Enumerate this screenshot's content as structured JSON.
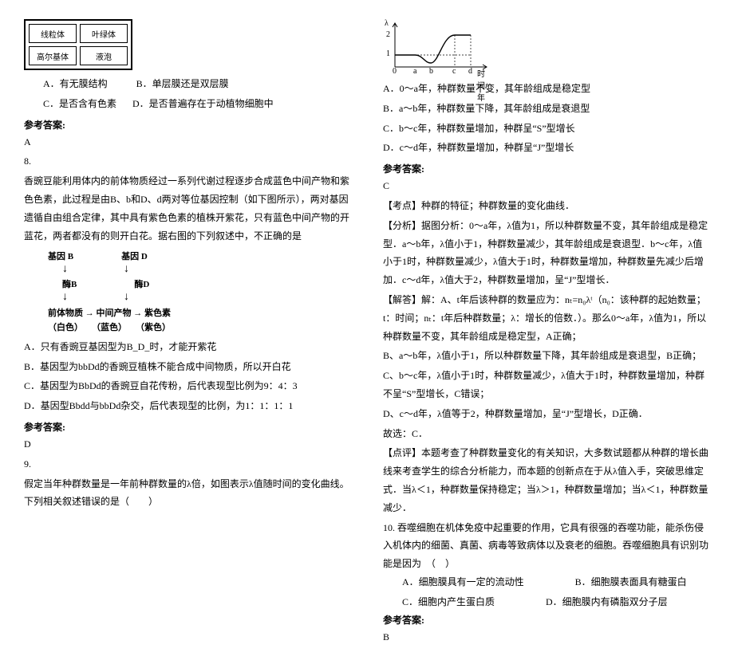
{
  "left": {
    "cell_labels": [
      "线粒体",
      "叶绿体",
      "高尔基体",
      "液泡"
    ],
    "q7_optA": "A．有无膜结构",
    "q7_optB": "B．单层膜还是双层膜",
    "q7_optC": "C．是否含有色素",
    "q7_optD": "D．是否普遍存在于动植物细胞中",
    "ref_label": "参考答案:",
    "q7_ans": "A",
    "q8_num": "8.",
    "q8_text": "香豌豆能利用体内的前体物质经过一系列代谢过程逐步合成蓝色中间产物和紫色色素，此过程是由B、b和D、d两对等位基因控制（如下图所示），两对基因遗循自由组合定律，其中具有紫色色素的植株开紫花，只有蓝色中间产物的开蓝花，两者都没有的则开白花。据右图的下列叙述中，不正确的是",
    "geneB": "基因 B",
    "geneD": "基因 D",
    "enzymeB": "酶B",
    "enzymeD": "酶D",
    "bottom_line": "前体物质 → 中间产物 → 紫色素",
    "bottom_colors": "（白色）　　（蓝色）　　（紫色）",
    "q8_optA": "A．只有香豌豆基因型为B_D_时，才能开紫花",
    "q8_optB": "B．基因型为bbDd的香豌豆植株不能合成中间物质，所以开白花",
    "q8_optC": "C．基因型为BbDd的香豌豆自花传粉，后代表现型比例为9：4：3",
    "q8_optD": "D．基因型Bbdd与bbDd杂交，后代表现型的比例，为1：1：1：1",
    "q8_ans": "D",
    "q9_num": "9.",
    "q9_text": "假定当年种群数量是一年前种群数量的λ倍，如图表示λ值随时间的变化曲线。下列相关叙述错误的是（　　）"
  },
  "right": {
    "axis_y": "λ",
    "axis_x": "时间/年",
    "x_ticks": [
      "0",
      "a",
      "b",
      "c",
      "d"
    ],
    "q9_optA": "A．0～a年，种群数量不变，其年龄组成是稳定型",
    "q9_optB": "B．a～b年，种群数量下降，其年龄组成是衰退型",
    "q9_optC": "C．b～c年，种群数量增加，种群呈“S”型增长",
    "q9_optD": "D．c～d年，种群数量增加，种群呈“J”型增长",
    "ref_label": "参考答案:",
    "q9_ans": "C",
    "kaodian": "【考点】种群的特征；种群数量的变化曲线．",
    "fenxi": "【分析】据图分析：0～a年，λ值为1，所以种群数量不变，其年龄组成是稳定型．a～b年，λ值小于1，种群数量减少，其年龄组成是衰退型．b～c年，λ值小于1时，种群数量减少，λ值大于1时，种群数量增加，种群数量先减少后增加．c～d年，λ值大于2，种群数量增加，呈“J”型增长．",
    "jieda_head": "【解答】解：A、t年后该种群的数量应为：nₜ=n₀λᵗ（n₀：该种群的起始数量；t：时间；nₜ：t年后种群数量；λ：增长的倍数．）。那么0～a年，λ值为1，所以种群数量不变，其年龄组成是稳定型，A正确；",
    "jieda_B": "B、a～b年，λ值小于1，所以种群数量下降，其年龄组成是衰退型，B正确；",
    "jieda_C": "C、b～c年，λ值小于1时，种群数量减少，λ值大于1时，种群数量增加，种群不呈“S”型增长，C错误；",
    "jieda_D": "D、c～d年，λ值等于2，种群数量增加，呈“J”型增长，D正确．",
    "gx": "故选：C．",
    "dianping": "【点评】本题考查了种群数量变化的有关知识，大多数试题都从种群的增长曲线来考查学生的综合分析能力，而本题的创新点在于从λ值入手，突破思维定式．当λ＜1，种群数量保持稳定；当λ＞1，种群数量增加；当λ＜1，种群数量减少．",
    "q10_text": "10. 吞噬细胞在机体免疫中起重要的作用，它具有很强的吞噬功能，能杀伤侵入机体内的细菌、真菌、病毒等致病体以及衰老的细胞。吞噬细胞具有识别功能是因为　（　）",
    "q10_optA": "A．细胞膜具有一定的流动性",
    "q10_optB": "B．细胞膜表面具有糖蛋白",
    "q10_optC": "C．细胞内产生蛋白质",
    "q10_optD": "D．细胞膜内有磷脂双分子层",
    "q10_ans": "B"
  }
}
